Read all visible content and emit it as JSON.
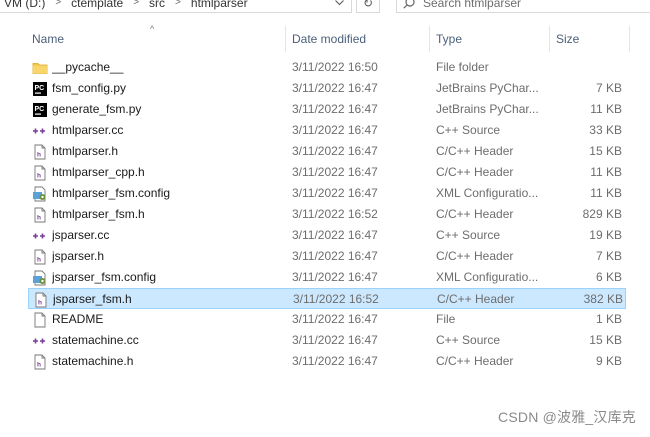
{
  "address_bar": {
    "crumbs": [
      "VM (D:)",
      "ctemplate",
      "src",
      "htmlparser"
    ],
    "separator": ">",
    "refresh_glyph": "↻",
    "search_placeholder": "Search htmlparser"
  },
  "columns": {
    "name": "Name",
    "date": "Date modified",
    "type": "Type",
    "size": "Size",
    "sort_indicator": "^"
  },
  "files": [
    {
      "icon": "folder-icon",
      "name": "__pycache__",
      "date": "3/11/2022 16:50",
      "type": "File folder",
      "size": ""
    },
    {
      "icon": "pycharm-icon",
      "name": "fsm_config.py",
      "date": "3/11/2022 16:47",
      "type": "JetBrains PyChar...",
      "size": "7 KB"
    },
    {
      "icon": "pycharm-icon",
      "name": "generate_fsm.py",
      "date": "3/11/2022 16:47",
      "type": "JetBrains PyChar...",
      "size": "11 KB"
    },
    {
      "icon": "cpp-source-icon",
      "name": "htmlparser.cc",
      "date": "3/11/2022 16:47",
      "type": "C++ Source",
      "size": "33 KB"
    },
    {
      "icon": "header-file-icon",
      "name": "htmlparser.h",
      "date": "3/11/2022 16:47",
      "type": "C/C++ Header",
      "size": "15 KB"
    },
    {
      "icon": "header-file-icon",
      "name": "htmlparser_cpp.h",
      "date": "3/11/2022 16:47",
      "type": "C/C++ Header",
      "size": "11 KB"
    },
    {
      "icon": "xml-config-icon",
      "name": "htmlparser_fsm.config",
      "date": "3/11/2022 16:47",
      "type": "XML Configuratio...",
      "size": "11 KB"
    },
    {
      "icon": "header-file-icon",
      "name": "htmlparser_fsm.h",
      "date": "3/11/2022 16:52",
      "type": "C/C++ Header",
      "size": "829 KB"
    },
    {
      "icon": "cpp-source-icon",
      "name": "jsparser.cc",
      "date": "3/11/2022 16:47",
      "type": "C++ Source",
      "size": "19 KB"
    },
    {
      "icon": "header-file-icon",
      "name": "jsparser.h",
      "date": "3/11/2022 16:47",
      "type": "C/C++ Header",
      "size": "7 KB"
    },
    {
      "icon": "xml-config-icon",
      "name": "jsparser_fsm.config",
      "date": "3/11/2022 16:47",
      "type": "XML Configuratio...",
      "size": "6 KB"
    },
    {
      "icon": "header-file-icon",
      "name": "jsparser_fsm.h",
      "date": "3/11/2022 16:52",
      "type": "C/C++ Header",
      "size": "382 KB",
      "selected": true
    },
    {
      "icon": "plain-file-icon",
      "name": "README",
      "date": "3/11/2022 16:47",
      "type": "File",
      "size": "1 KB"
    },
    {
      "icon": "cpp-source-icon",
      "name": "statemachine.cc",
      "date": "3/11/2022 16:47",
      "type": "C++ Source",
      "size": "15 KB"
    },
    {
      "icon": "header-file-icon",
      "name": "statemachine.h",
      "date": "3/11/2022 16:47",
      "type": "C/C++ Header",
      "size": "9 KB"
    }
  ],
  "watermark": "CSDN @波雅_汉库克",
  "colors": {
    "selection_bg": "#cce8ff",
    "selection_border": "#99d1ff",
    "header_text": "#4c607a",
    "folder": "#f5c542",
    "cpp_plus": "#7a3d9c"
  }
}
